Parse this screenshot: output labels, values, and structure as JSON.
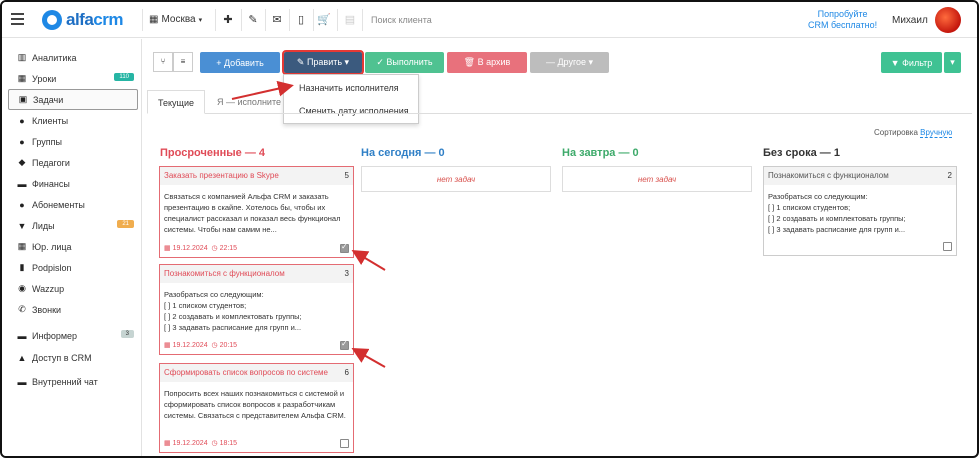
{
  "header": {
    "brand_a": "alfa",
    "brand_b": "crm",
    "city": "Москва",
    "search_placeholder": "Поиск клиента",
    "promo_line1": "Попробуйте",
    "promo_line2": "CRM бесплатно!",
    "user": "Михаил"
  },
  "sidebar": {
    "items": [
      {
        "label": "Аналитика",
        "icon": "chart-icon"
      },
      {
        "label": "Уроки",
        "icon": "calendar-icon",
        "badge": "110"
      },
      {
        "label": "Задачи",
        "icon": "tasks-icon"
      },
      {
        "label": "Клиенты",
        "icon": "user-icon"
      },
      {
        "label": "Группы",
        "icon": "group-icon"
      },
      {
        "label": "Педагоги",
        "icon": "teacher-icon"
      },
      {
        "label": "Финансы",
        "icon": "money-icon"
      },
      {
        "label": "Абонементы",
        "icon": "subscription-icon"
      },
      {
        "label": "Лиды",
        "icon": "funnel-icon",
        "badge": "21"
      },
      {
        "label": "Юр. лица",
        "icon": "building-icon"
      },
      {
        "label": "Podpislon",
        "icon": "document-icon"
      },
      {
        "label": "Wazzup",
        "icon": "whatsapp-icon"
      },
      {
        "label": "Звонки",
        "icon": "phone-icon"
      },
      {
        "label": "Информер",
        "icon": "informer-icon",
        "badge": "3"
      },
      {
        "label": "Доступ в CRM",
        "icon": "lock-icon"
      },
      {
        "label": "Внутренний чат",
        "icon": "chat-icon"
      }
    ]
  },
  "toolbar": {
    "add": "+ Добавить",
    "edit": "✎ Править ▾",
    "complete": "✓ Выполнить",
    "archive": "🗑 В архив",
    "other": "— Другое ▾",
    "filter": "▼ Фильтр"
  },
  "dropdown": {
    "item1": "Назначить исполнителя",
    "item2": "Сменить дату исполнения"
  },
  "tabs": {
    "current": "Текущие",
    "mine": "Я — исполните"
  },
  "sort": {
    "label": "Сортировка",
    "value": "Вручную"
  },
  "columns": {
    "overdue": "Просроченные — 4",
    "today": "На сегодня — 0",
    "tomorrow": "На завтра — 0",
    "nodate": "Без срока — 1",
    "empty": "нет задач"
  },
  "colors": {
    "overdue": "#e04b57",
    "today": "#2f7fc6",
    "tomorrow": "#3daa6a",
    "nodate": "#333333"
  },
  "cards": [
    {
      "title": "Заказать презентацию в Skype",
      "num": "5",
      "body": "Связаться с компанией Альфа CRM и заказать презентацию в скайпе. Хотелось бы, чтобы их специалист рассказал и показал весь функционал системы. Чтобы нам самим не...",
      "date": "19.12.2024",
      "time": "22:15",
      "checked": true
    },
    {
      "title": "Познакомиться с функционалом",
      "num": "3",
      "body": "Разобраться со следующим:\n[ ] 1 списком студентов;\n[ ] 2 создавать и комплектовать группы;\n[ ] 3 задавать расписание для групп и...",
      "date": "19.12.2024",
      "time": "20:15",
      "checked": true
    },
    {
      "title": "Сформировать список вопросов по системе",
      "num": "6",
      "body": "Попросить всех наших познакомиться с системой и сформировать список вопросов к разработчикам системы. Связаться с представителем Альфа CRM.",
      "date": "19.12.2024",
      "time": "18:15",
      "checked": false
    }
  ],
  "nodate_card": {
    "title": "Познакомиться с функционалом",
    "num": "2",
    "body": "Разобраться со следующим:\n[ ] 1 списком студентов;\n[ ] 2 создавать и комплектовать группы;\n[ ] 3 задавать расписание для групп и..."
  }
}
